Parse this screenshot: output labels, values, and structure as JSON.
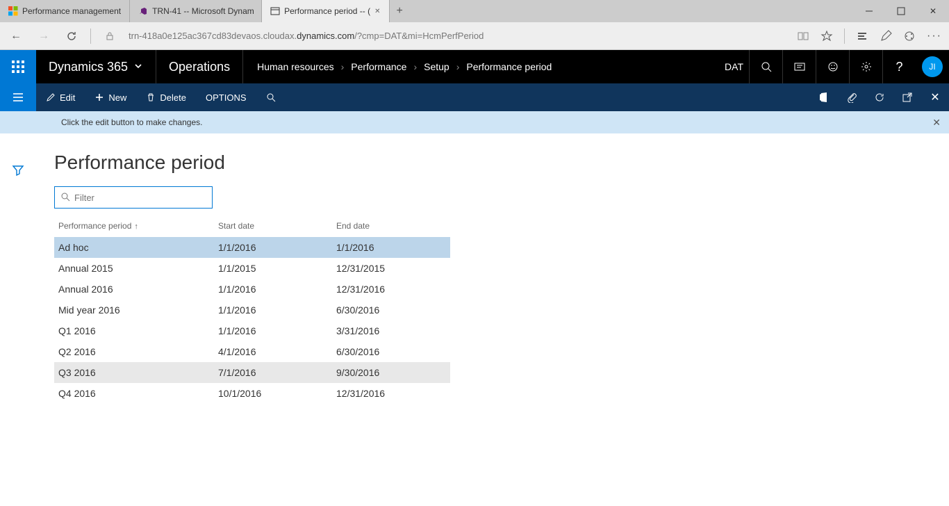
{
  "tabs": [
    {
      "label": "Performance management",
      "active": false,
      "tabid": "tab-perf"
    },
    {
      "label": "TRN-41 -- Microsoft Dynam",
      "active": false,
      "tabid": "tab-trn41"
    },
    {
      "label": "Performance period -- (",
      "active": true,
      "tabid": "tab-perfperiod"
    }
  ],
  "addr": {
    "pre": "trn-418a0e125ac367cd83devaos.cloudax.",
    "domain": "dynamics.com",
    "suffix": "/?cmp=DAT&mi=HcmPerfPeriod"
  },
  "brand": "Dynamics 365",
  "brand2": "Operations",
  "breadcrumb": [
    "Human resources",
    "Performance",
    "Setup",
    "Performance period"
  ],
  "company": "DAT",
  "avatar": "JI",
  "actions": {
    "edit": "Edit",
    "new": "New",
    "delete": "Delete",
    "options": "OPTIONS"
  },
  "info": "Click the edit button to make changes.",
  "page_title": "Performance period",
  "filter_placeholder": "Filter",
  "columns": [
    "Performance period",
    "Start date",
    "End date"
  ],
  "rows": [
    {
      "name": "Ad hoc",
      "start": "1/1/2016",
      "end": "1/1/2016",
      "selected": true
    },
    {
      "name": "Annual 2015",
      "start": "1/1/2015",
      "end": "12/31/2015"
    },
    {
      "name": "Annual 2016",
      "start": "1/1/2016",
      "end": "12/31/2016"
    },
    {
      "name": "Mid year 2016",
      "start": "1/1/2016",
      "end": "6/30/2016"
    },
    {
      "name": "Q1 2016",
      "start": "1/1/2016",
      "end": "3/31/2016"
    },
    {
      "name": "Q2 2016",
      "start": "4/1/2016",
      "end": "6/30/2016"
    },
    {
      "name": "Q3 2016",
      "start": "7/1/2016",
      "end": "9/30/2016",
      "hover": true
    },
    {
      "name": "Q4 2016",
      "start": "10/1/2016",
      "end": "12/31/2016"
    }
  ]
}
